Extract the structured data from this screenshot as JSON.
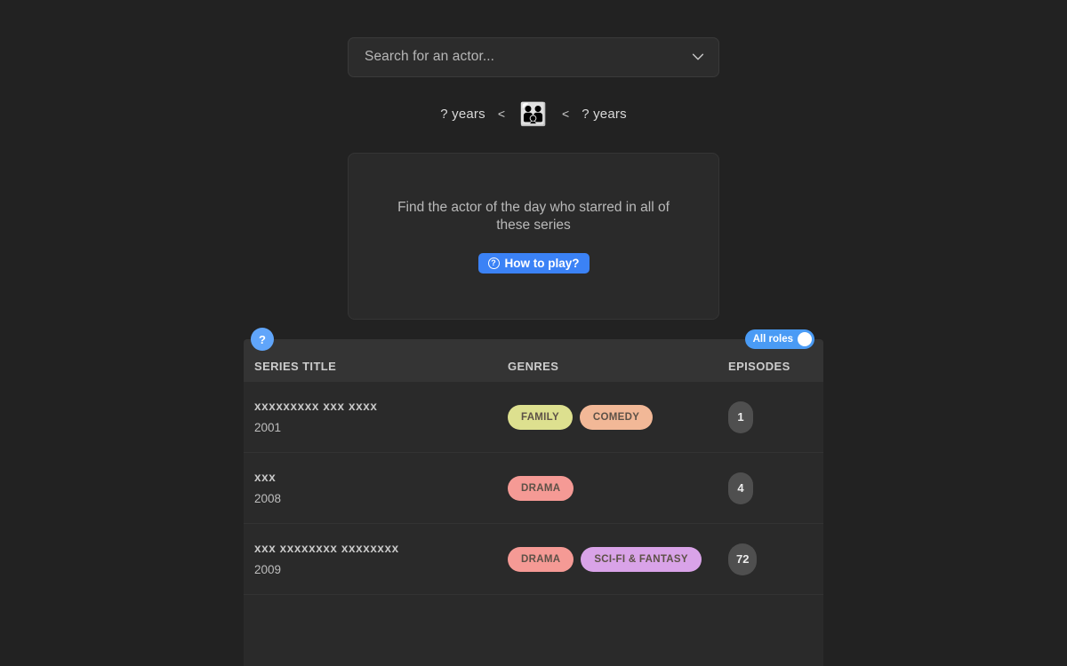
{
  "search": {
    "placeholder": "Search for an actor...",
    "value": "",
    "dropdown_icon": "chevron-down-icon"
  },
  "age_hint": {
    "lower_label": "? years",
    "operator_left": "<",
    "emoji": "👪",
    "operator_right": "<",
    "upper_label": "? years"
  },
  "hint_card": {
    "text": "Find the actor of the day who starred in all of these series",
    "button_label": "How to play?",
    "button_icon_glyph": "?",
    "button_color": "#3b82f6"
  },
  "table": {
    "help_badge": "?",
    "roles_toggle": {
      "label": "All roles",
      "enabled": true,
      "color": "#4a9bf5"
    },
    "columns": [
      "SERIES TITLE",
      "GENRES",
      "EPISODES"
    ],
    "rows": [
      {
        "title": "xxxxxxxxx xxx xxxx",
        "year": "2001",
        "genres": [
          {
            "label": "FAMILY",
            "color": "#dde08f"
          },
          {
            "label": "COMEDY",
            "color": "#f2b897"
          }
        ],
        "episodes": "1"
      },
      {
        "title": "xxx",
        "year": "2008",
        "genres": [
          {
            "label": "DRAMA",
            "color": "#f59a95"
          }
        ],
        "episodes": "4"
      },
      {
        "title": "xxx xxxxxxxx xxxxxxxx",
        "year": "2009",
        "genres": [
          {
            "label": "DRAMA",
            "color": "#f59a95"
          },
          {
            "label": "SCI-FI & FANTASY",
            "color": "#d9a3e8"
          }
        ],
        "episodes": "72"
      },
      {
        "title": "",
        "year": "",
        "genres": [],
        "episodes": ""
      }
    ]
  },
  "theme": {
    "page_background": "#222222",
    "panel_background": "#2a2a2a",
    "header_background": "#343434",
    "accent": "#3b82f6"
  }
}
